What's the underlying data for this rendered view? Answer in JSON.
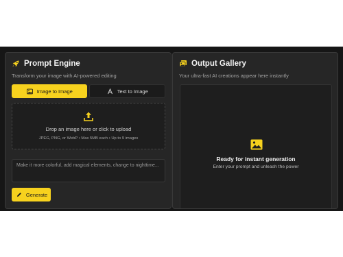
{
  "colors": {
    "accent": "#f7d21e",
    "background": "#161616",
    "panel": "#262626"
  },
  "prompt_engine": {
    "icon": "rocket-icon",
    "title": "Prompt Engine",
    "subtitle": "Transform your image with AI-powered editing",
    "tabs": [
      {
        "label": "Image to Image",
        "icon": "image-icon",
        "active": true
      },
      {
        "label": "Text to Image",
        "icon": "text-icon",
        "active": false
      }
    ],
    "upload": {
      "icon": "upload-icon",
      "main": "Drop an image here or click to upload",
      "sub": "JPEG, PNG, or WebP • Max 5MB each • Up to 9 images"
    },
    "prompt_placeholder": "Make it more colorful, add magical elements, change to nighttime...",
    "generate_label": "Generate"
  },
  "output_gallery": {
    "icon": "gallery-icon",
    "title": "Output Gallery",
    "subtitle": "Your ultra-fast AI creations appear here instantly",
    "empty": {
      "icon": "image-placeholder-icon",
      "title": "Ready for instant generation",
      "sub": "Enter your prompt and unleash the power"
    }
  }
}
